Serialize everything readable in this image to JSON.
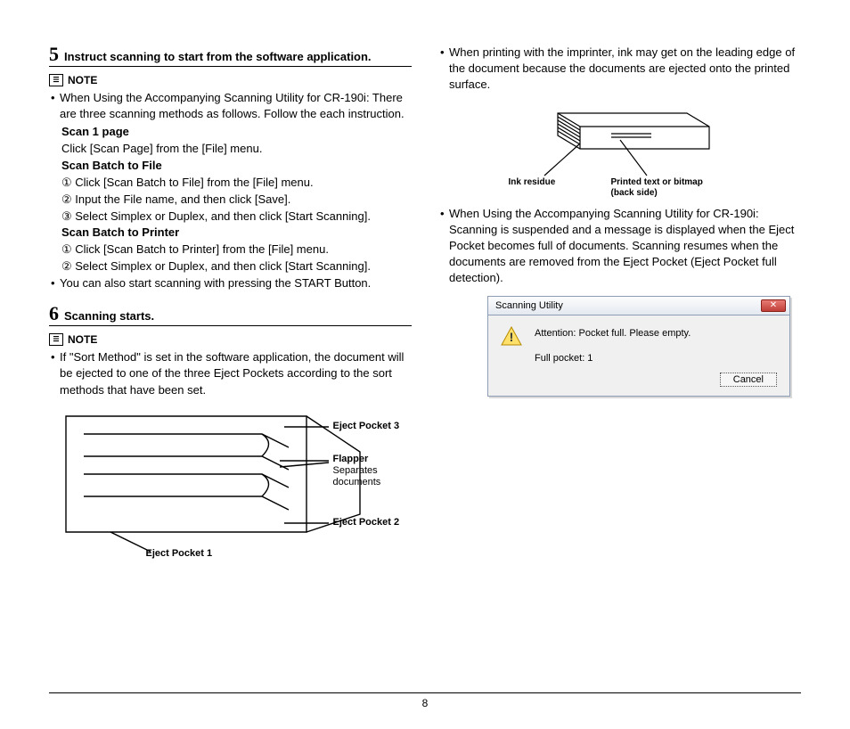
{
  "page_number": "8",
  "left": {
    "step5": {
      "num": "5",
      "title": "Instruct scanning to start from the software application.",
      "note_label": "NOTE",
      "bullet1": "When Using the Accompanying Scanning Utility for CR-190i: There are three scanning methods as follows. Follow the each instruction.",
      "scan1_head": "Scan 1 page",
      "scan1_line": "Click [Scan Page] from the [File] menu.",
      "scanbf_head": "Scan Batch to File",
      "scanbf_1": "① Click [Scan Batch to File] from the [File] menu.",
      "scanbf_2": "② Input the File name, and then click [Save].",
      "scanbf_3": "③ Select Simplex or Duplex, and then click [Start Scanning].",
      "scanbp_head": "Scan Batch to Printer",
      "scanbp_1": "① Click [Scan Batch to Printer] from the [File] menu.",
      "scanbp_2": "② Select Simplex or Duplex, and then click [Start Scanning].",
      "bullet2": "You can also start scanning with pressing the START Button."
    },
    "step6": {
      "num": "6",
      "title": "Scanning starts.",
      "note_label": "NOTE",
      "bullet1": "If \"Sort Method\" is set in the software application, the document will be ejected to one of the three Eject Pockets according to the sort methods that have been set.",
      "labels": {
        "ep3": "Eject Pocket 3",
        "flapper": "Flapper",
        "flapper_sub": "Separates documents",
        "ep2": "Eject Pocket 2",
        "ep1": "Eject Pocket 1"
      }
    }
  },
  "right": {
    "bullet1": "When printing with the imprinter, ink may get on the leading edge of the document because the documents are ejected onto the printed surface.",
    "ink_labels": {
      "ink": "Ink residue",
      "printed_l1": "Printed text or bitmap",
      "printed_l2": "(back side)"
    },
    "bullet2": "When Using the Accompanying Scanning Utility for CR-190i: Scanning is suspended and a message is displayed when the Eject Pocket becomes full of documents. Scanning resumes when the documents are removed from the Eject Pocket (Eject Pocket full detection).",
    "dialog": {
      "title": "Scanning Utility",
      "msg": "Attention: Pocket full. Please empty.",
      "sub": "Full pocket:    1",
      "cancel": "Cancel"
    }
  }
}
